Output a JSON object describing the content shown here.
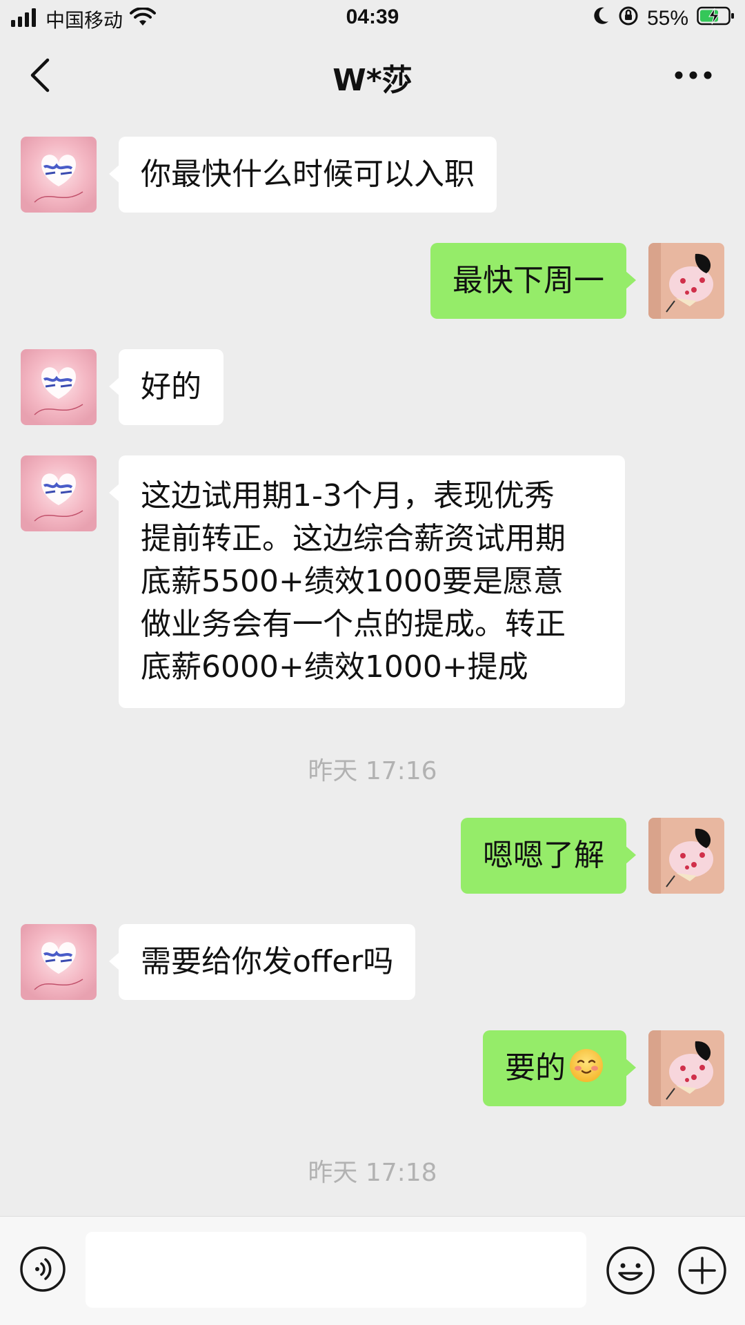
{
  "status_bar": {
    "carrier": "中国移动",
    "time": "04:39",
    "battery": "55%"
  },
  "nav": {
    "title": "W*莎",
    "back_icon": "chevron-left-icon",
    "more_icon": "more-dots-icon"
  },
  "messages": [
    {
      "side": "left",
      "text": "你最快什么时候可以入职"
    },
    {
      "side": "right",
      "text": "最快下周一"
    },
    {
      "side": "left",
      "text": "好的"
    },
    {
      "side": "left",
      "lines": [
        "这边试用期1-3个月，表现优秀",
        "提前转正。这边综合薪资试用期",
        "底薪5500+绩效1000要是愿意",
        "做业务会有一个点的提成。转正",
        "底薪6000+绩效1000+提成"
      ]
    },
    {
      "side": "right",
      "text": "嗯嗯了解"
    },
    {
      "side": "left",
      "text": "需要给你发offer吗"
    },
    {
      "side": "right",
      "text": "要的",
      "emoji": "smiling-face-icon"
    }
  ],
  "timestamps": [
    "昨天 17:16",
    "昨天 17:18"
  ],
  "input_bar": {
    "placeholder": "",
    "voice_icon": "voice-icon",
    "emoji_icon": "emoji-icon",
    "plus_icon": "plus-icon"
  },
  "colors": {
    "background": "#ededed",
    "bubble_self": "#95ec69",
    "bubble_other": "#ffffff",
    "timestamp": "#b2b2b2"
  }
}
